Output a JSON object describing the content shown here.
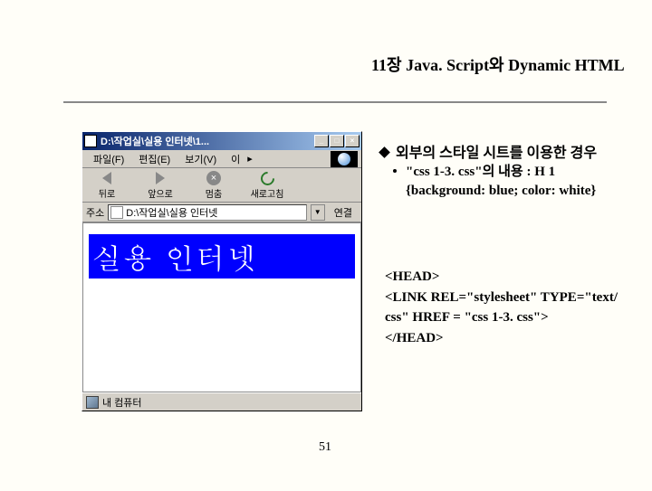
{
  "title": "11장 Java. Script와 Dynamic HTML",
  "bullet_main": "외부의 스타일 시트를 이용한 경우",
  "sub_bullet": "\"css 1-3. css\"의 내용 : H 1 {background: blue; color: white}",
  "code": {
    "l1": "<HEAD>",
    "l2": "<LINK REL=\"stylesheet\" TYPE=\"text/ css\" HREF = \"css 1-3. css\">",
    "l3": "</HEAD>"
  },
  "page_number": "51",
  "ie": {
    "title": "D:\\작업실\\실용 인터넷\\1...",
    "menu": {
      "file": "파일(F)",
      "edit": "편집(E)",
      "view": "보기(V)",
      "more": "이"
    },
    "toolbar": {
      "back": "뒤로",
      "forward": "앞으로",
      "stop": "멈춤",
      "refresh": "새로고침"
    },
    "address": {
      "label": "주소",
      "value": "D:\\작업실\\실용 인터넷",
      "go": "연결"
    },
    "content_h1": "실용 인터넷",
    "status": "내 컴퓨터"
  }
}
